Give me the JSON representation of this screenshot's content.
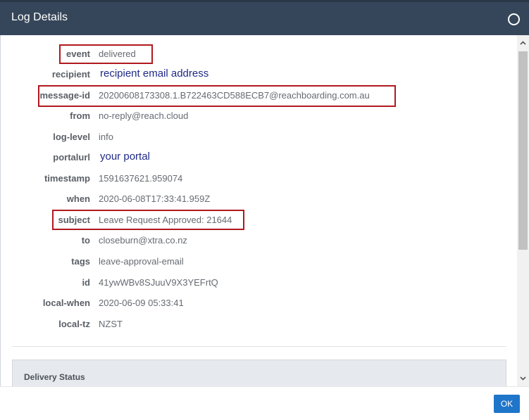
{
  "dialog": {
    "title": "Log Details"
  },
  "fields": [
    {
      "key": "event",
      "value": "delivered"
    },
    {
      "key": "recipient",
      "value": "recipient email address"
    },
    {
      "key": "message-id",
      "value": "20200608173308.1.B722463CD588ECB7@reachboarding.com.au"
    },
    {
      "key": "from",
      "value": "no-reply@reach.cloud"
    },
    {
      "key": "log-level",
      "value": "info"
    },
    {
      "key": "portalurl",
      "value": "your portal"
    },
    {
      "key": "timestamp",
      "value": "1591637621.959074"
    },
    {
      "key": "when",
      "value": "2020-06-08T17:33:41.959Z"
    },
    {
      "key": "subject",
      "value": "Leave Request Approved: 21644"
    },
    {
      "key": "to",
      "value": "closeburn@xtra.co.nz"
    },
    {
      "key": "tags",
      "value": "leave-approval-email"
    },
    {
      "key": "id",
      "value": "41ywWBv8SJuuV9X3YEFrtQ"
    },
    {
      "key": "local-when",
      "value": "2020-06-09 05:33:41"
    },
    {
      "key": "local-tz",
      "value": "NZST"
    }
  ],
  "delivery_panel": {
    "title": "Delivery Status"
  },
  "footer": {
    "ok_label": "OK"
  },
  "colors": {
    "titlebar": "#36465a",
    "highlight": "#b0191f",
    "ok_button": "#1f75c9"
  },
  "icons": {
    "close": "circle-close-icon",
    "scroll_up": "chevron-up-icon",
    "scroll_down": "chevron-down-icon"
  }
}
